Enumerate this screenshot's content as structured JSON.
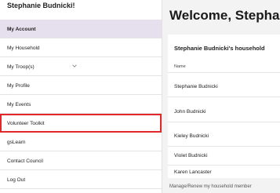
{
  "sidebar": {
    "user_name": "Stephanie Budnicki!",
    "items": [
      {
        "label": "My Account"
      },
      {
        "label": "My Household"
      },
      {
        "label": "My Troop(s)"
      },
      {
        "label": "My Profile"
      },
      {
        "label": "My Events"
      },
      {
        "label": "Volunteer Toolkit"
      },
      {
        "label": "gsLearn"
      },
      {
        "label": "Contact Council"
      },
      {
        "label": "Log Out"
      }
    ]
  },
  "main": {
    "welcome": "Welcome, Stepha",
    "household_title": "Stephanie Budnicki's household",
    "column_name": "Name",
    "members": [
      {
        "name": "Stephanie Budnicki"
      },
      {
        "name": "John Budnicki"
      },
      {
        "name": "Kieley Budnicki"
      },
      {
        "name": "Violet Budnicki"
      },
      {
        "name": "Karen Lancaster"
      }
    ],
    "manage_link": "Manage/Renew my household member"
  },
  "colors": {
    "active_bg": "#e6e0ee",
    "highlight_border": "#e4272b"
  }
}
